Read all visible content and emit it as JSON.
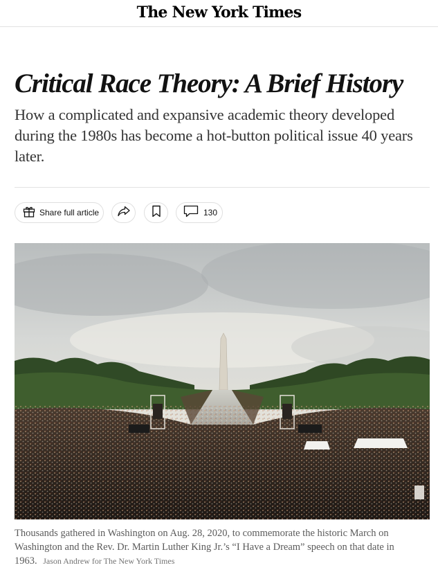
{
  "masthead": {
    "logo": "The New York Times"
  },
  "headline": "Critical Race Theory: A Brief History",
  "dek": "How a complicated and expansive academic theory developed during the 1980s has become a hot-button political issue 40 years later.",
  "toolbar": {
    "share_full_label": "Share full article",
    "share_icon": "share-arrow-icon",
    "save_icon": "bookmark-icon",
    "comment_icon": "comment-icon",
    "comment_count": "130"
  },
  "photo": {
    "alt": "Crowd at the Lincoln Memorial Reflecting Pool with the Washington Monument in the distance"
  },
  "caption": {
    "text": "Thousands gathered in Washington on Aug. 28, 2020, to commemorate the historic March on Washington and the Rev. Dr. Martin Luther King Jr.’s “I Have a Dream” speech on that date in 1963.",
    "credit": "Jason Andrew for The New York Times"
  }
}
